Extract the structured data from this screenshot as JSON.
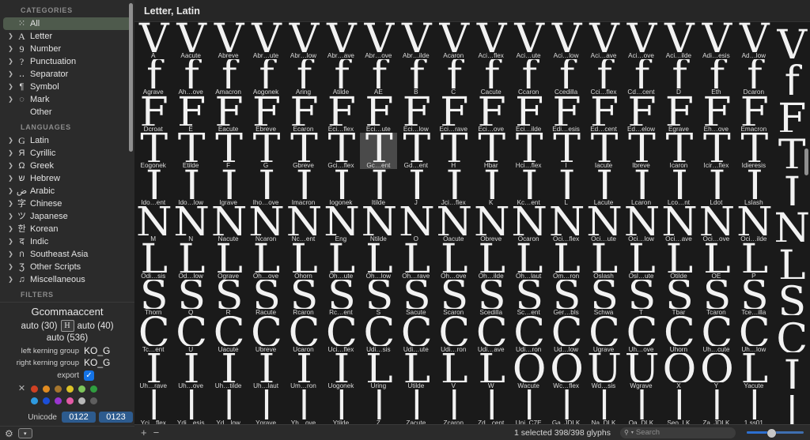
{
  "sidebar": {
    "categories_title": "CATEGORIES",
    "categories": [
      {
        "label": "All",
        "icon": "grid-icon",
        "glyph": "⁙",
        "expandable": false,
        "selected": true
      },
      {
        "label": "Letter",
        "icon": "letter-a-icon",
        "glyph": "A",
        "expandable": true,
        "selected": false
      },
      {
        "label": "Number",
        "icon": "number-nine-icon",
        "glyph": "9",
        "expandable": true,
        "selected": false
      },
      {
        "label": "Punctuation",
        "icon": "question-mark-icon",
        "glyph": "?",
        "expandable": true,
        "selected": false
      },
      {
        "label": "Separator",
        "icon": "separator-dots-icon",
        "glyph": "‥",
        "expandable": true,
        "selected": false
      },
      {
        "label": "Symbol",
        "icon": "pilcrow-icon",
        "glyph": "¶",
        "expandable": true,
        "selected": false
      },
      {
        "label": "Mark",
        "icon": "mark-dotted-circle-icon",
        "glyph": "◌",
        "expandable": true,
        "selected": false
      },
      {
        "label": "Other",
        "icon": "none",
        "glyph": "",
        "expandable": false,
        "selected": false
      }
    ],
    "languages_title": "LANGUAGES",
    "languages": [
      {
        "label": "Latin",
        "icon": "latin-g-icon",
        "glyph": "G"
      },
      {
        "label": "Cyrillic",
        "icon": "cyrillic-ya-icon",
        "glyph": "Я"
      },
      {
        "label": "Greek",
        "icon": "greek-omega-icon",
        "glyph": "Ω"
      },
      {
        "label": "Hebrew",
        "icon": "hebrew-shin-icon",
        "glyph": "ש"
      },
      {
        "label": "Arabic",
        "icon": "arabic-dad-icon",
        "glyph": "ض"
      },
      {
        "label": "Chinese",
        "icon": "chinese-zi-icon",
        "glyph": "字"
      },
      {
        "label": "Japanese",
        "icon": "japanese-tsu-icon",
        "glyph": "ツ"
      },
      {
        "label": "Korean",
        "icon": "korean-han-icon",
        "glyph": "한"
      },
      {
        "label": "Indic",
        "icon": "devanagari-de-icon",
        "glyph": "द"
      },
      {
        "label": "Southeast Asia",
        "icon": "thai-icon",
        "glyph": "ก"
      },
      {
        "label": "Other Scripts",
        "icon": "other-scripts-icon",
        "glyph": "Ʒ"
      },
      {
        "label": "Miscellaneous",
        "icon": "music-note-icon",
        "glyph": "♫"
      }
    ],
    "filters_title": "FILTERS"
  },
  "inspector": {
    "glyph_name": "Gcommaaccent",
    "left_sidebearing": "auto (30)",
    "metric_badge_glyph": "H",
    "right_sidebearing": "auto (40)",
    "width": "auto (536)",
    "left_kerning_group_label": "left kerning group",
    "left_kerning_group_value": "KO_G",
    "right_kerning_group_label": "right kerning group",
    "right_kerning_group_value": "KO_G",
    "export_label": "export",
    "export_checked": true,
    "checkmark": "✓",
    "color_clear_icon": "✕",
    "colors_row1": [
      "#cf4023",
      "#e08b21",
      "#a6762e",
      "#ddc226",
      "#7ec65a",
      "#2f9e3f"
    ],
    "colors_row2": [
      "#2e9ae0",
      "#1b4fd8",
      "#9a35cf",
      "#e35aa6",
      "#b7b7b7",
      "#5e5e5e"
    ],
    "unicode_label": "Unicode",
    "unicode_value_1": "0122",
    "unicode_value_2": "0123",
    "gear_icon": "⚙",
    "popup_icon": "▾"
  },
  "main": {
    "header_title": "Letter, Latin",
    "columns": 18,
    "rows": [
      [
        "A",
        "Aacute",
        "Abreve",
        "Abr…ute",
        "Abr…low",
        "Abr…ave",
        "Abr…ove",
        "Abr…ilde",
        "Acaron",
        "Aci…flex",
        "Aci…ute",
        "Aci…low",
        "Aci…ave",
        "Aci…ove",
        "Aci…ilde",
        "Adi…esis",
        "Ad…low"
      ],
      [
        "Agrave",
        "Ah…ove",
        "Amacron",
        "Aogonek",
        "Aring",
        "Atilde",
        "AE",
        "B",
        "C",
        "Cacute",
        "Ccaron",
        "Ccedilla",
        "Cci…flex",
        "Cd…cent",
        "D",
        "Eth",
        "Dcaron"
      ],
      [
        "Dcroat",
        "E",
        "Eacute",
        "Ebreve",
        "Ecaron",
        "Eci…flex",
        "Eci…ute",
        "Eci…low",
        "Eci…rave",
        "Eci…ove",
        "Eci…ilde",
        "Edi…esis",
        "Ed…cent",
        "Ed…elow",
        "Egrave",
        "Eh…ove",
        "Emacron"
      ],
      [
        "Eogonek",
        "Etilde",
        "F",
        "G",
        "Gbreve",
        "Gci…flex",
        "Gc…ent",
        "Gd…ent",
        "H",
        "Hbar",
        "Hci…flex",
        "I",
        "Iacute",
        "Ibreve",
        "Icaron",
        "Icir…flex",
        "Idieresis"
      ],
      [
        "Ido…ent",
        "Ido…low",
        "Igrave",
        "Iho…ove",
        "Imacron",
        "Iogonek",
        "Itilde",
        "J",
        "Jci…flex",
        "K",
        "Kc…ent",
        "L",
        "Lacute",
        "Lcaron",
        "Lco…nt",
        "Ldot",
        "Lslash"
      ],
      [
        "M",
        "N",
        "Nacute",
        "Ncaron",
        "Nc…ent",
        "Eng",
        "Ntilde",
        "O",
        "Oacute",
        "Obreve",
        "Ocaron",
        "Oci…flex",
        "Oci…ute",
        "Oci…low",
        "Oci…ave",
        "Oci…ove",
        "Oci…ilde"
      ],
      [
        "Odi…sis",
        "Od…low",
        "Ograve",
        "Oh…ove",
        "Ohorn",
        "Oh…ute",
        "Oh…low",
        "Oh…rave",
        "Oh…ove",
        "Oh…ilde",
        "Oh…laut",
        "Om…ron",
        "Oslash",
        "Osl…ute",
        "Otilde",
        "OE",
        "P"
      ],
      [
        "Thorn",
        "Q",
        "R",
        "Racute",
        "Rcaron",
        "Rc…ent",
        "S",
        "Sacute",
        "Scaron",
        "Scedilla",
        "Sc…ent",
        "Ger…bls",
        "Schwa",
        "T",
        "Tbar",
        "Tcaron",
        "Tce…illa"
      ],
      [
        "Tc…ent",
        "U",
        "Uacute",
        "Ubreve",
        "Ucaron",
        "Uci…flex",
        "Udi…sis",
        "Udi…ute",
        "Udi…ron",
        "Udi…ave",
        "Udi…ron",
        "Ud…low",
        "Ugrave",
        "Uh…ove",
        "Uhorn",
        "Uh…cute",
        "Uh…low"
      ],
      [
        "Uh…rave",
        "Uh…ove",
        "Uh…tilde",
        "Uh…laut",
        "Um…ron",
        "Uogonek",
        "Uring",
        "Utilde",
        "V",
        "W",
        "Wacute",
        "Wc…flex",
        "Wd…sis",
        "Wgrave",
        "X",
        "Y",
        "Yacute"
      ],
      [
        "Yci…flex",
        "Ydi…esis",
        "Yd…low",
        "Ygrave",
        "Yh…ove",
        "Ytilde",
        "Z",
        "Zacute",
        "Zcaron",
        "Zd…cent",
        "Uni_C7E",
        "Ga_JDLK",
        "Na_DLK",
        "Oa_DLK",
        "Seo_LK",
        "Za_JDLK",
        "1.ss01"
      ]
    ],
    "row_art": [
      "VVVVVVVVVVVVVVVVVV",
      "ƒƒƒƒƒƒƒƒƒƒƒƒƒƒƒƒƒƒ",
      "FFFFFFFFFFFFFFFFFF",
      "TTTTTTTTTTTTTTTTTT",
      "JJJJJJJJJJJJJJJJJJ",
      "NNNNNNNNNNNNNNNNNN",
      "LLLLLLLLLLLLLLLLLL",
      "SSSSSSSSSSSSSSSSSS",
      "CCCCCCCCCCCCCCCCCC",
      "IIIIIILLLLOOUUOOLJ",
      "|||||||||||||||||"
    ],
    "selected_row": 3,
    "selected_col": 6
  },
  "bottombar": {
    "add_icon": "+",
    "remove_icon": "−",
    "status": "1 selected 398/398 glyphs",
    "search_icon": "⚲",
    "search_caret": "▾",
    "search_placeholder": "Search",
    "slider_value": 36
  }
}
